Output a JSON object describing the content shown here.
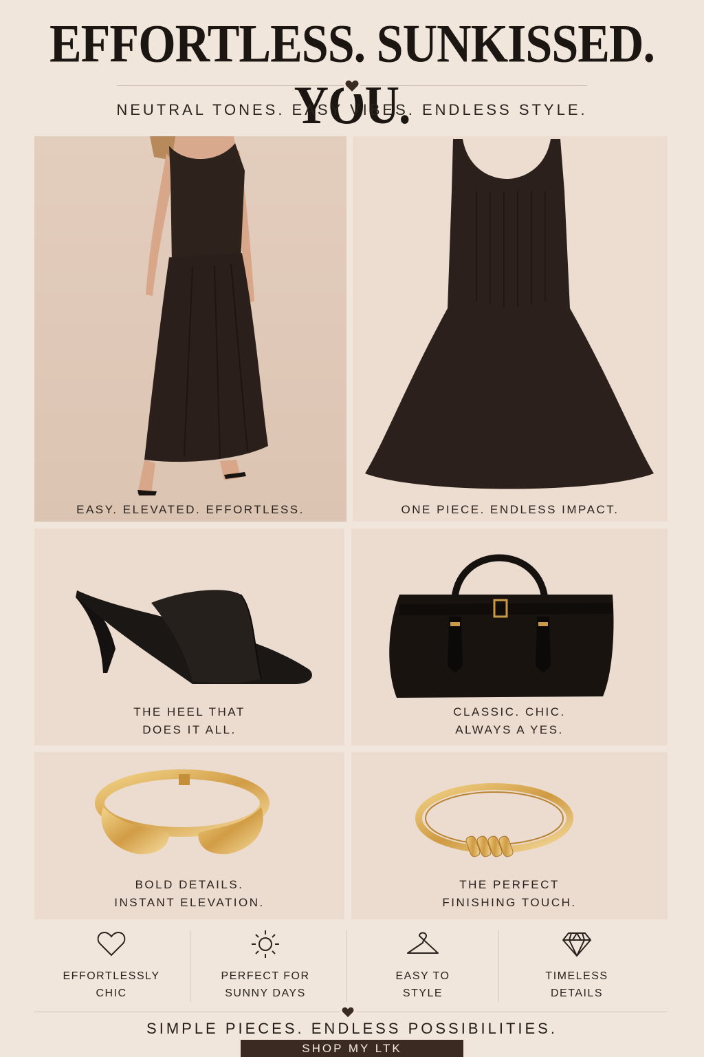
{
  "header": {
    "headline": "EFFORTLESS. SUNKISSED. YOU.",
    "subheadline": "NEUTRAL TONES. EASY VIBES. ENDLESS STYLE."
  },
  "tiles": [
    {
      "caption_lines": [
        "EASY. ELEVATED. EFFORTLESS."
      ]
    },
    {
      "caption_lines": [
        "ONE PIECE. ENDLESS IMPACT."
      ]
    },
    {
      "caption_lines": [
        "THE HEEL THAT",
        "DOES IT ALL."
      ]
    },
    {
      "caption_lines": [
        "CLASSIC. CHIC.",
        "ALWAYS A YES."
      ]
    },
    {
      "caption_lines": [
        "BOLD DETAILS.",
        "INSTANT ELEVATION."
      ]
    },
    {
      "caption_lines": [
        "THE PERFECT",
        "FINISHING TOUCH."
      ]
    }
  ],
  "features": [
    {
      "icon": "heart-outline-icon",
      "lines": [
        "EFFORTLESSLY",
        "CHIC"
      ]
    },
    {
      "icon": "sun-icon",
      "lines": [
        "PERFECT FOR",
        "SUNNY DAYS"
      ]
    },
    {
      "icon": "hanger-icon",
      "lines": [
        "EASY TO",
        "STYLE"
      ]
    },
    {
      "icon": "diamond-icon",
      "lines": [
        "TIMELESS",
        "DETAILS"
      ]
    }
  ],
  "footer": {
    "tagline": "SIMPLE PIECES. ENDLESS POSSIBILITIES.",
    "cta_label": "SHOP MY LTK"
  },
  "colors": {
    "background": "#f1e6dc",
    "tile": "#ead9cb",
    "garment": "#2b201b",
    "gold": "#d8a955",
    "accent": "#3b2a22"
  }
}
